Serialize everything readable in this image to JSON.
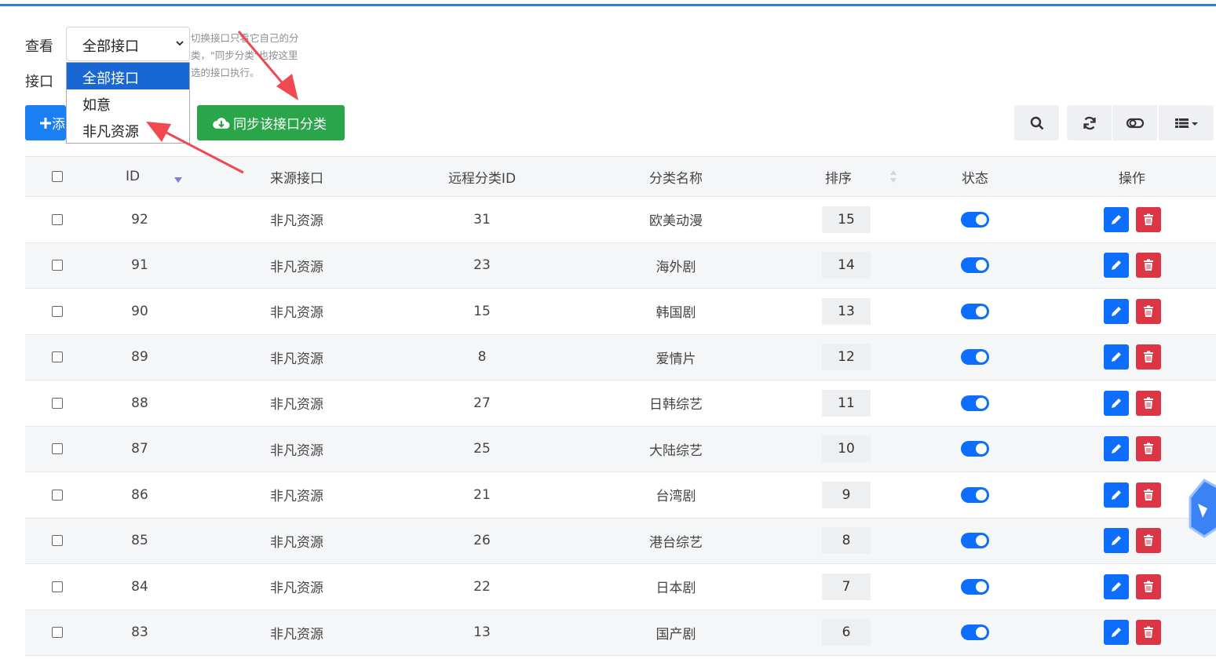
{
  "filter": {
    "view_label": "查看",
    "api_label": "接口",
    "selected": "全部接口",
    "options": [
      "全部接口",
      "如意",
      "非凡资源"
    ],
    "hint_lines": [
      "切换接口只看它自己的分",
      "类，\"同步分类\"也按这里",
      "选的接口执行。"
    ]
  },
  "toolbar": {
    "add_label": "添",
    "sync_label": "同步该接口分类",
    "search_icon": "search-icon",
    "refresh_icon": "refresh-icon",
    "toggle_icon": "toggle-view-icon",
    "columns_icon": "columns-icon"
  },
  "table": {
    "headers": [
      "ID",
      "来源接口",
      "远程分类ID",
      "分类名称",
      "排序",
      "状态",
      "操作"
    ],
    "rows": [
      {
        "id": "92",
        "source": "非凡资源",
        "remote_id": "31",
        "name": "欧美动漫",
        "sort": "15"
      },
      {
        "id": "91",
        "source": "非凡资源",
        "remote_id": "23",
        "name": "海外剧",
        "sort": "14"
      },
      {
        "id": "90",
        "source": "非凡资源",
        "remote_id": "15",
        "name": "韩国剧",
        "sort": "13"
      },
      {
        "id": "89",
        "source": "非凡资源",
        "remote_id": "8",
        "name": "爱情片",
        "sort": "12"
      },
      {
        "id": "88",
        "source": "非凡资源",
        "remote_id": "27",
        "name": "日韩综艺",
        "sort": "11"
      },
      {
        "id": "87",
        "source": "非凡资源",
        "remote_id": "25",
        "name": "大陆综艺",
        "sort": "10"
      },
      {
        "id": "86",
        "source": "非凡资源",
        "remote_id": "21",
        "name": "台湾剧",
        "sort": "9"
      },
      {
        "id": "85",
        "source": "非凡资源",
        "remote_id": "26",
        "name": "港台综艺",
        "sort": "8"
      },
      {
        "id": "84",
        "source": "非凡资源",
        "remote_id": "22",
        "name": "日本剧",
        "sort": "7"
      },
      {
        "id": "83",
        "source": "非凡资源",
        "remote_id": "13",
        "name": "国产剧",
        "sort": "6"
      }
    ]
  },
  "colors": {
    "primary": "#0d6efd",
    "success": "#2aa54a",
    "danger": "#dc3545",
    "arrow": "#f0494f"
  }
}
